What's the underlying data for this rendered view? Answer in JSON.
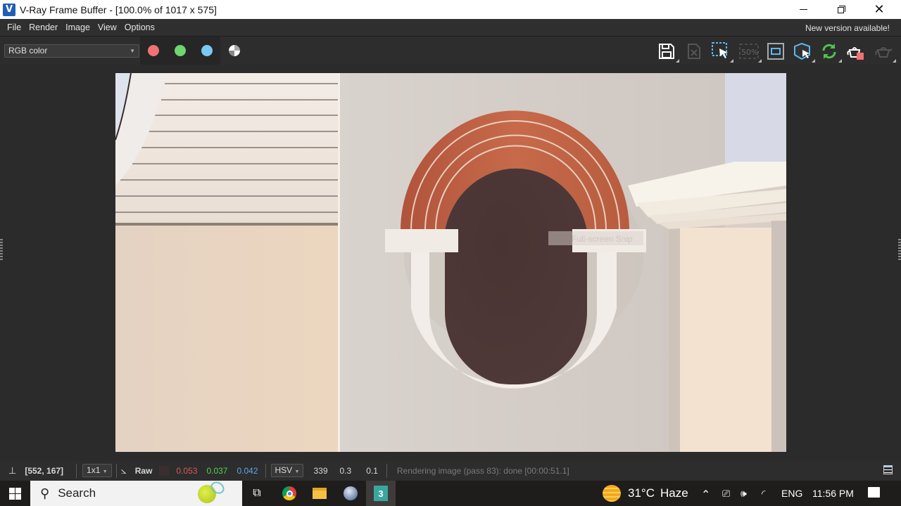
{
  "window": {
    "title": "V-Ray Frame Buffer - [100.0% of 1017 x 575]",
    "app_icon": "vray-logo-icon",
    "controls": [
      "minimize-icon",
      "restore-icon",
      "close-icon"
    ]
  },
  "menubar": {
    "items": [
      "File",
      "Render",
      "Image",
      "View",
      "Options"
    ],
    "notice": "New version available!"
  },
  "toolbar": {
    "channel": "RGB color",
    "channel_buttons": [
      {
        "name": "red-channel",
        "color": "#f07272"
      },
      {
        "name": "green-channel",
        "color": "#6fd56f"
      },
      {
        "name": "blue-channel",
        "color": "#7cc8f5"
      },
      {
        "name": "alpha-channel",
        "color": "#ffffff"
      }
    ],
    "tools": [
      {
        "name": "save-image-icon",
        "enabled": true
      },
      {
        "name": "clear-image-icon",
        "enabled": false
      },
      {
        "name": "region-render-icon",
        "enabled": true
      },
      {
        "name": "zoom-50-icon",
        "enabled": false,
        "label": "50%"
      },
      {
        "name": "link-to-viewport-icon",
        "enabled": true
      },
      {
        "name": "interactive-render-icon",
        "enabled": true
      },
      {
        "name": "refresh-icon",
        "enabled": true
      },
      {
        "name": "stop-render-teapot-icon",
        "enabled": true
      },
      {
        "name": "render-teapot-icon",
        "enabled": false
      }
    ]
  },
  "render": {
    "watermark": "Full-screen Snip"
  },
  "statusbar": {
    "coords": "[552, 167]",
    "sample_size": "1x1",
    "mode": "Raw",
    "rgb": {
      "r": "0.053",
      "g": "0.037",
      "b": "0.042"
    },
    "rgb_colors": {
      "r": "#e05656",
      "g": "#56d156",
      "b": "#5ea6e8"
    },
    "color_space": "HSV",
    "hsv": {
      "h": "339",
      "s": "0.3",
      "v": "0.1"
    },
    "message": "Rendering image (pass 83): done [00:00:51.1]"
  },
  "taskbar": {
    "search_placeholder": "Search",
    "apps": [
      "task-view-icon",
      "chrome-icon",
      "file-explorer-icon",
      "sketchup-icon",
      "3ds-max-icon"
    ],
    "weather": {
      "temp": "31°C",
      "condition": "Haze"
    },
    "language": "ENG",
    "time": "11:56 PM"
  }
}
